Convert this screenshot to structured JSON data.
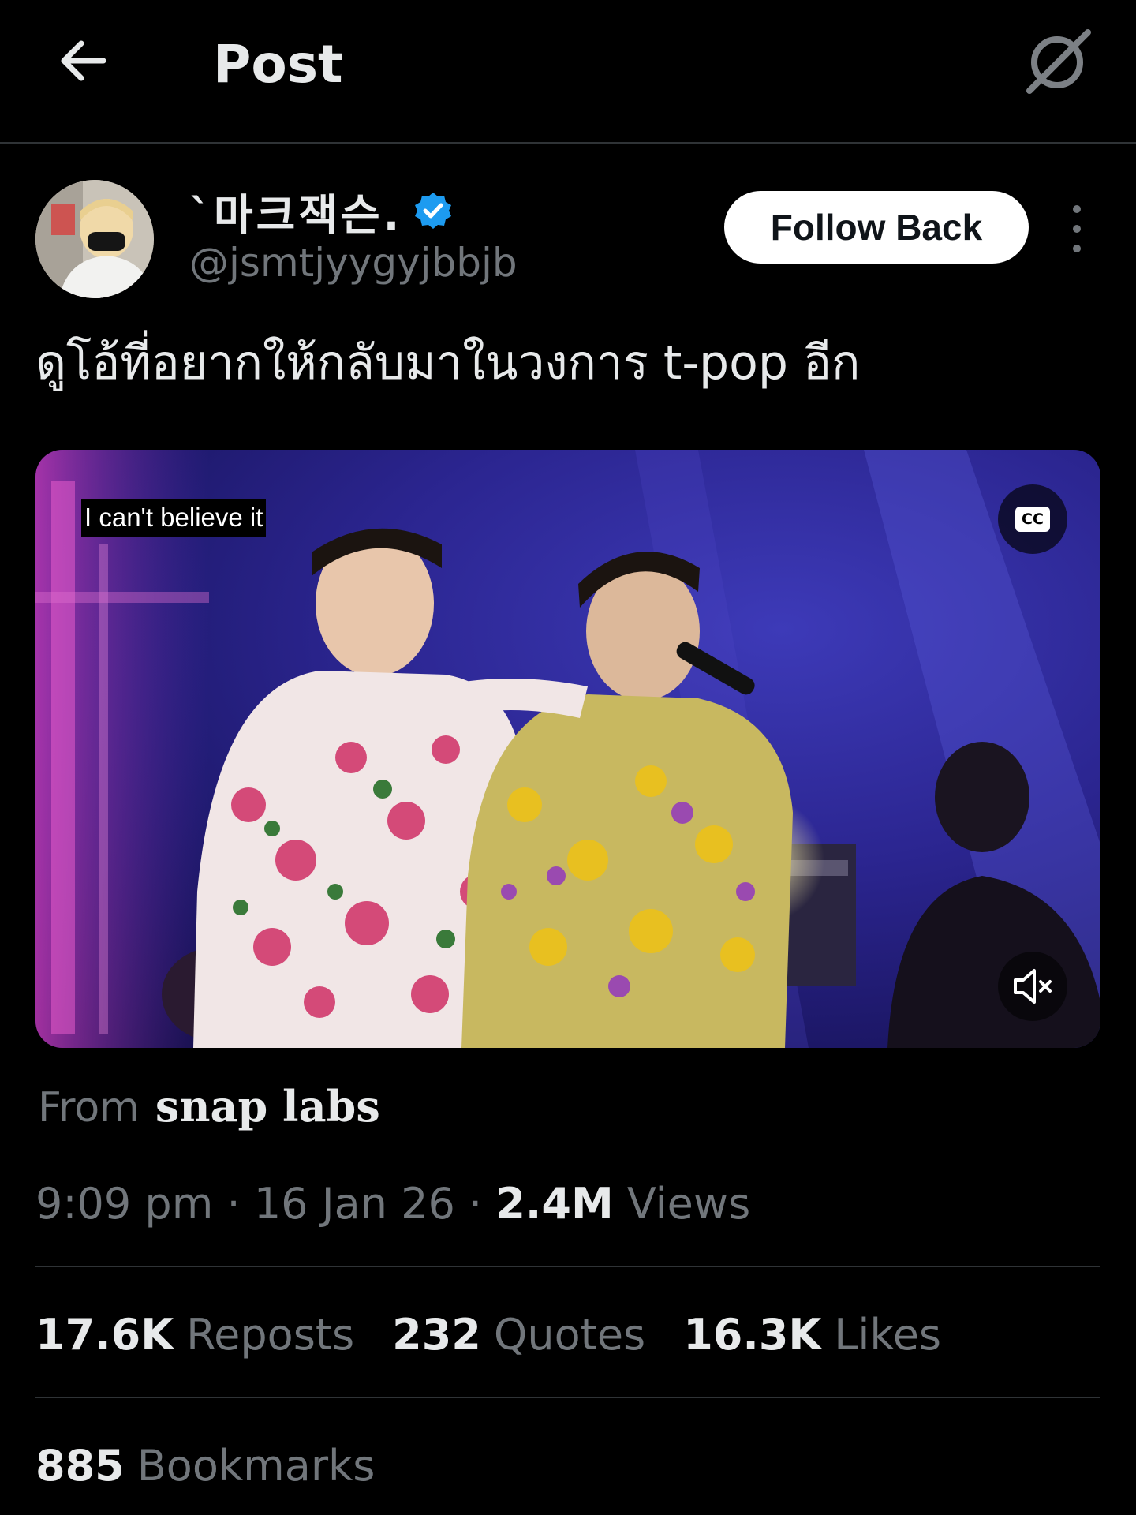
{
  "header": {
    "title": "Post",
    "back_icon": "arrow-left-icon",
    "grok_icon": "grok-icon"
  },
  "author": {
    "display_name": "`마크잭슨.",
    "handle": "@jsmtjyygyjbbjb",
    "verified": true,
    "verified_color": "#1d9bf0",
    "follow_label": "Follow Back"
  },
  "post": {
    "text": "ดูโอ้ที่อยากให้กลับมาในวงการ t-pop อีก"
  },
  "media": {
    "subtitle": "I can't believe it",
    "cc_label": "CC",
    "muted": true
  },
  "source": {
    "label": "From",
    "name": "snap labs"
  },
  "meta": {
    "time": "9:09 pm",
    "date": "16 Jan 26",
    "views_count": "2.4M",
    "views_label": "Views"
  },
  "stats": {
    "reposts_count": "17.6K",
    "reposts_label": "Reposts",
    "quotes_count": "232",
    "quotes_label": "Quotes",
    "likes_count": "16.3K",
    "likes_label": "Likes",
    "bookmarks_count": "885",
    "bookmarks_label": "Bookmarks"
  },
  "colors": {
    "background": "#000000",
    "text_primary": "#e7e9ea",
    "text_secondary": "#71767b",
    "divider": "#2f3336"
  }
}
